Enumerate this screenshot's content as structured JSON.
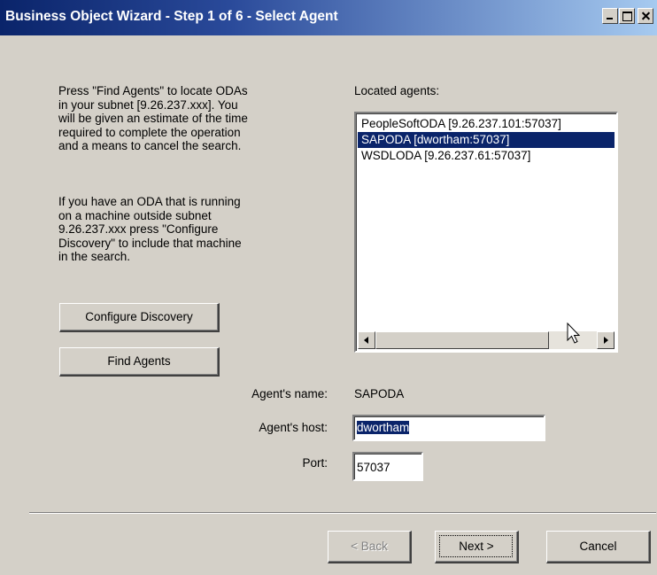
{
  "window": {
    "title": "Business Object Wizard - Step 1 of 6 - Select Agent",
    "title_buttons": [
      "minimize",
      "maximize",
      "close"
    ]
  },
  "instructions": {
    "paragraph1": "Press \"Find Agents\" to locate ODAs\nin your subnet [9.26.237.xxx]. You\nwill be given an estimate of the time\nrequired to complete the operation\nand a means to cancel the search.",
    "paragraph2": "If you have an ODA that is running\non a machine outside subnet\n9.26.237.xxx press \"Configure\nDiscovery\" to include that machine\nin the search."
  },
  "buttons": {
    "configure_discovery": "Configure Discovery",
    "find_agents": "Find Agents",
    "back": "< Back",
    "next": "Next >",
    "cancel": "Cancel"
  },
  "agents": {
    "label": "Located agents:",
    "items": [
      {
        "text": "PeopleSoftODA [9.26.237.101:57037]",
        "selected": false
      },
      {
        "text": "SAPODA [dwortham:57037]",
        "selected": true
      },
      {
        "text": "WSDLODA [9.26.237.61:57037]",
        "selected": false
      }
    ]
  },
  "fields": {
    "name_label": "Agent's name:",
    "name_value": "SAPODA",
    "host_label": "Agent's host:",
    "host_value": "dwortham",
    "port_label": "Port:",
    "port_value": "57037"
  },
  "colors": {
    "title_bar_start": "#0a246a",
    "title_bar_end": "#a6caf0",
    "selection": "#0a246a",
    "face": "#d4d0c8"
  },
  "icons": {
    "cursor": "mouse-pointer-icon",
    "scroll_left": "arrow-left-icon",
    "scroll_right": "arrow-right-icon"
  }
}
